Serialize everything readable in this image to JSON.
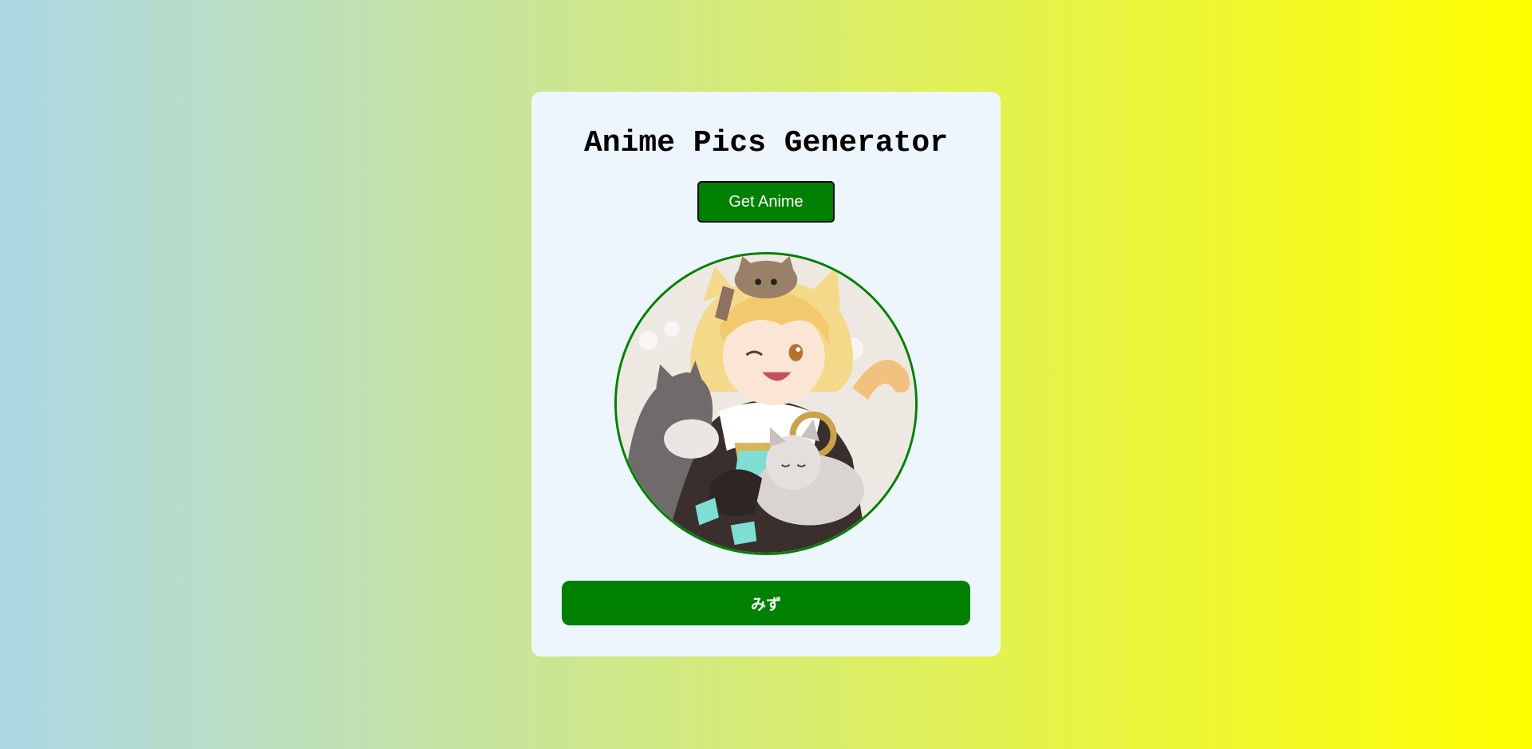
{
  "app": {
    "title": "Anime Pics Generator",
    "button_label": "Get Anime",
    "character_name": "みず",
    "image_alt": "anime-character-with-cats"
  },
  "colors": {
    "background_start": "#add8e6",
    "background_end": "#ffff00",
    "card": "#eef6fd",
    "accent": "#008000"
  }
}
